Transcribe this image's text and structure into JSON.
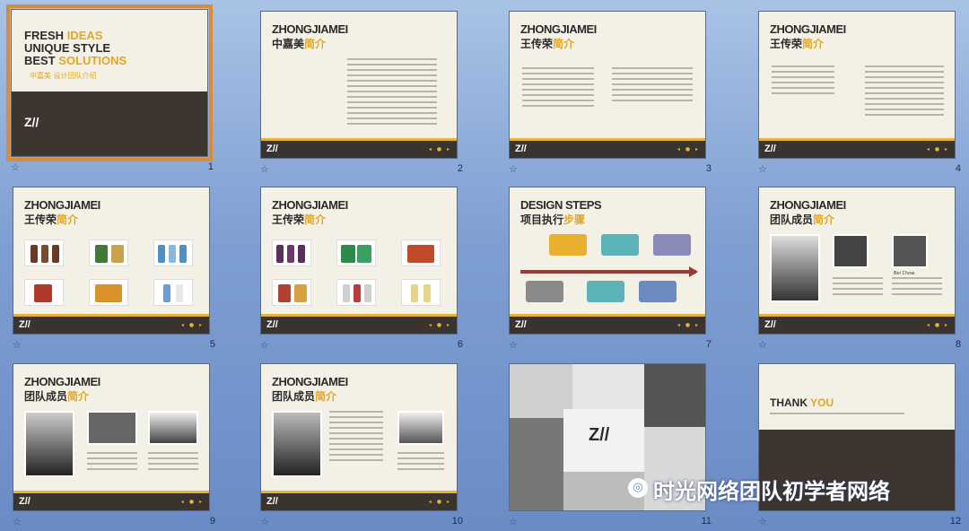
{
  "slides": [
    {
      "number": "1",
      "brand": "",
      "title_lines": [
        "FRESH",
        "IDEAS",
        "UNIQUE STYLE",
        "BEST",
        "SOLUTIONS"
      ],
      "subtitle": "中嘉美 设计团队介绍",
      "logo": "Z//"
    },
    {
      "number": "2",
      "brand": "ZHONGJIAMEI",
      "subtitle_main": "中嘉美",
      "subtitle_hl": "简介"
    },
    {
      "number": "3",
      "brand": "ZHONGJIAMEI",
      "subtitle_main": "王传荣",
      "subtitle_hl": "简介"
    },
    {
      "number": "4",
      "brand": "ZHONGJIAMEI",
      "subtitle_main": "王传荣",
      "subtitle_hl": "简介"
    },
    {
      "number": "5",
      "brand": "ZHONGJIAMEI",
      "subtitle_main": "王传荣",
      "subtitle_hl": "简介"
    },
    {
      "number": "6",
      "brand": "ZHONGJIAMEI",
      "subtitle_main": "王传荣",
      "subtitle_hl": "简介"
    },
    {
      "number": "7",
      "brand": "DESIGN STEPS",
      "subtitle_main": "项目执行",
      "subtitle_hl": "步骤"
    },
    {
      "number": "8",
      "brand": "ZHONGJIAMEI",
      "subtitle_main": "团队成员",
      "subtitle_hl": "简介"
    },
    {
      "number": "9",
      "brand": "ZHONGJIAMEI",
      "subtitle_main": "团队成员",
      "subtitle_hl": "简介"
    },
    {
      "number": "10",
      "brand": "ZHONGJIAMEI",
      "subtitle_main": "团队成员",
      "subtitle_hl": "简介"
    },
    {
      "number": "11",
      "brand": "",
      "logo": "Z//"
    },
    {
      "number": "12",
      "brand": "THANK",
      "brand_hl": "YOU"
    }
  ],
  "slide8_name": "Bei Chow",
  "star_glyph": "☆",
  "watermark": "时光网络团队初学者网络",
  "accent": "#e3a623",
  "selected_slide": "1"
}
